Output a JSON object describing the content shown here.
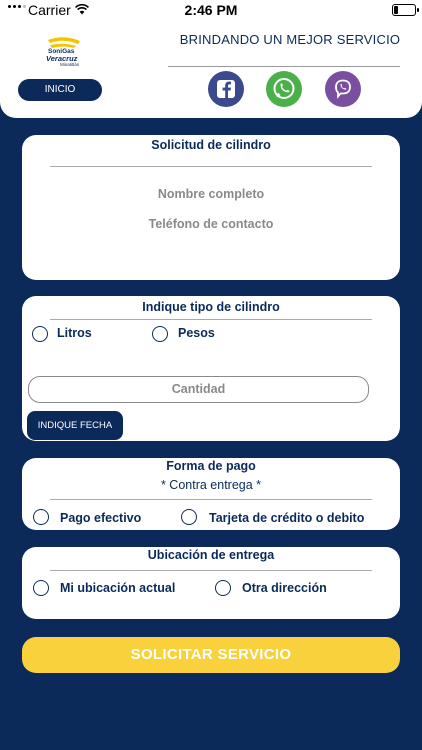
{
  "status_bar": {
    "carrier": "Carrier",
    "time": "2:46 PM"
  },
  "header": {
    "logo_line1": "SoniGas",
    "logo_line2": "Veracruz",
    "logo_line3": "Minatitlán",
    "tagline": "BRINDANDO UN MEJOR SERVICIO",
    "inicio_label": "INICIO",
    "social": [
      "facebook-icon",
      "whatsapp-icon",
      "viber-icon"
    ]
  },
  "solicitud": {
    "title": "Solicitud de cilindro",
    "name_placeholder": "Nombre completo",
    "phone_placeholder": "Teléfono de contacto"
  },
  "tipo": {
    "title": "Indique tipo de cilindro",
    "option_litros": "Litros",
    "option_pesos": "Pesos",
    "cantidad_placeholder": "Cantidad",
    "fecha_label": "INDIQUE FECHA"
  },
  "pago": {
    "title": "Forma de pago",
    "subtitle": "* Contra entrega *",
    "option_efectivo": "Pago efectivo",
    "option_tarjeta": "Tarjeta de crédito o debito"
  },
  "ubicacion": {
    "title": "Ubicación de entrega",
    "option_actual": "Mi ubicación actual",
    "option_otra": "Otra dirección"
  },
  "submit_label": "SOLICITAR SERVICIO",
  "colors": {
    "navy": "#0b2a5a",
    "yellow": "#f8d13c",
    "facebook": "#3b5998",
    "whatsapp": "#4ac959",
    "viber": "#7b519d"
  }
}
